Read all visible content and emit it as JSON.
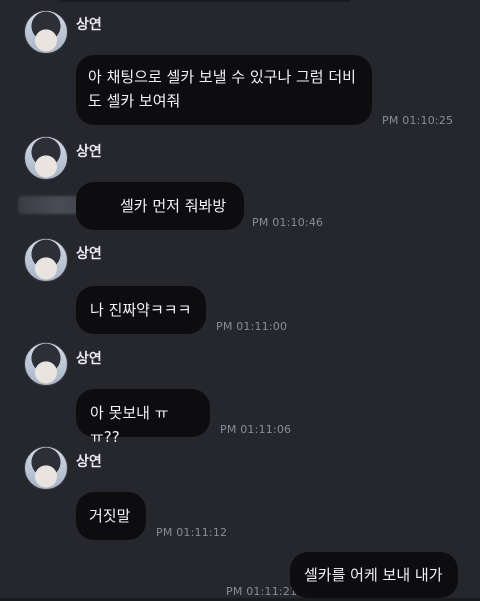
{
  "messages": [
    {
      "sender": "상연",
      "text": "아 채팅으로 셀카 보낼 수 있구나 그럼 더비\n도 셀카 보여줘",
      "time": "PM 01:10:25"
    },
    {
      "sender": "상연",
      "text": "셀카 먼저 줘봐방",
      "time": "PM 01:10:46"
    },
    {
      "sender": "상연",
      "text": "나 진짜약ㅋㅋㅋ",
      "time": "PM 01:11:00"
    },
    {
      "sender": "상연",
      "text": "아 못보내 ㅠㅠ??",
      "time": "PM 01:11:06"
    },
    {
      "sender": "상연",
      "text": "거짓말",
      "time": "PM 01:11:12"
    },
    {
      "sender": "me",
      "text": "셀카를 어케 보내 내가",
      "time": "PM 01:11:21"
    }
  ],
  "colors": {
    "background": "#26272d",
    "bubble": "#0d0d10",
    "text": "#f2f2f4",
    "time": "#8b8c93"
  }
}
